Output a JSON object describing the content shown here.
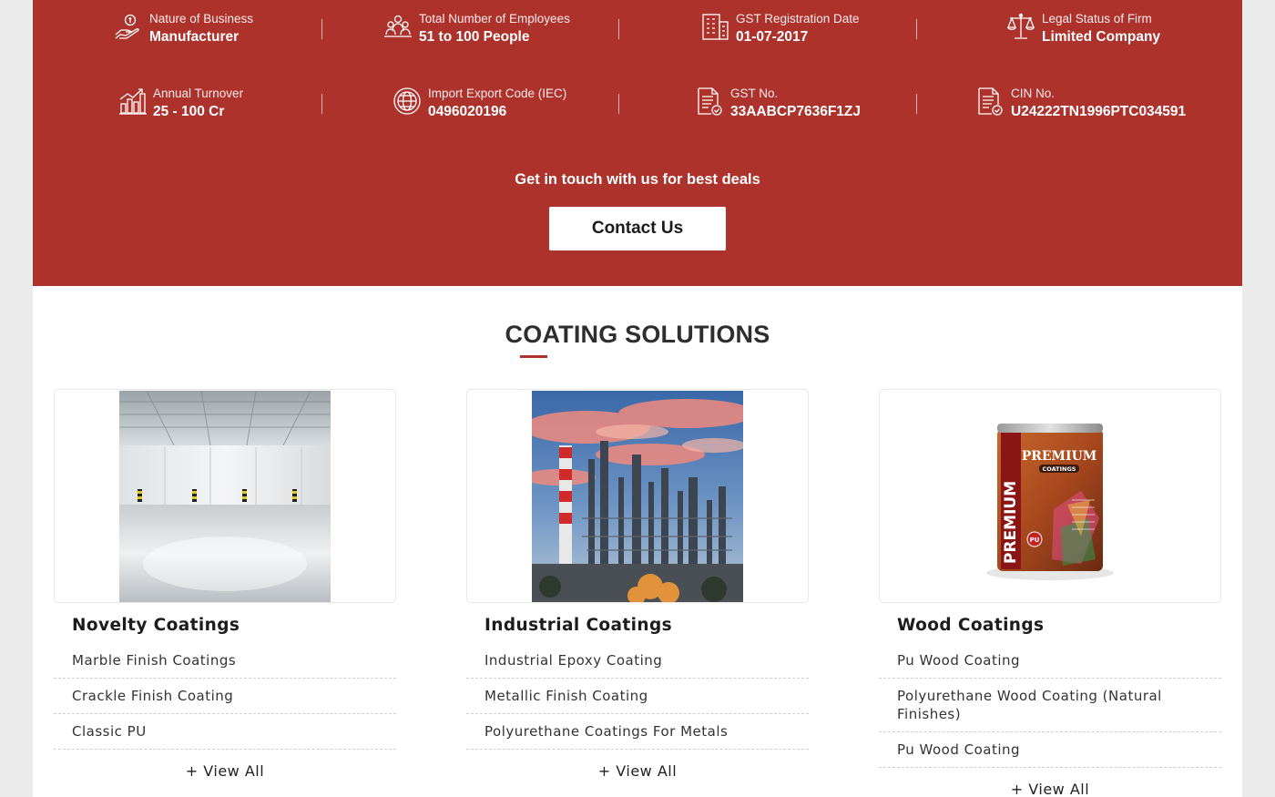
{
  "facts": [
    {
      "label": "Nature of Business",
      "value": "Manufacturer",
      "icon": "hand-coin-icon"
    },
    {
      "label": "Total Number of Employees",
      "value": "51 to 100 People",
      "icon": "employees-icon"
    },
    {
      "label": "GST Registration Date",
      "value": "01-07-2017",
      "icon": "building-icon"
    },
    {
      "label": "Legal Status of Firm",
      "value": "Limited Company",
      "icon": "scales-icon"
    },
    {
      "label": "Annual Turnover",
      "value": "25 - 100 Cr",
      "icon": "bar-chart-icon"
    },
    {
      "label": "Import Export Code (IEC)",
      "value": "0496020196",
      "icon": "globe-icon"
    },
    {
      "label": "GST No.",
      "value": "33AABCP7636F1ZJ",
      "icon": "document-check-icon"
    },
    {
      "label": "CIN No.",
      "value": "U24222TN1996PTC034591",
      "icon": "document-check-icon"
    }
  ],
  "cta": {
    "text": "Get in touch with us for best deals",
    "button": "Contact Us"
  },
  "section": {
    "title": "COATING SOLUTIONS"
  },
  "cards": [
    {
      "title": "Novelty Coatings",
      "items": [
        "Marble Finish Coatings",
        "Crackle Finish Coating",
        "Classic PU"
      ],
      "view_all": "+ View All"
    },
    {
      "title": "Industrial Coatings",
      "items": [
        "Industrial Epoxy Coating",
        "Metallic Finish Coating",
        "Polyurethane Coatings For Metals"
      ],
      "view_all": "+ View All"
    },
    {
      "title": "Wood Coatings",
      "items": [
        "Pu Wood Coating",
        "Polyurethane Wood Coating (Natural Finishes)",
        "Pu Wood Coating"
      ],
      "view_all": "+ View All"
    }
  ],
  "product_can": {
    "brand": "PREMIUM",
    "sub": "COATINGS",
    "side": "PREMIUM",
    "badge": "PU"
  },
  "colors": {
    "brand_red": "#ad322c",
    "text_dark": "#1c1c1c"
  }
}
